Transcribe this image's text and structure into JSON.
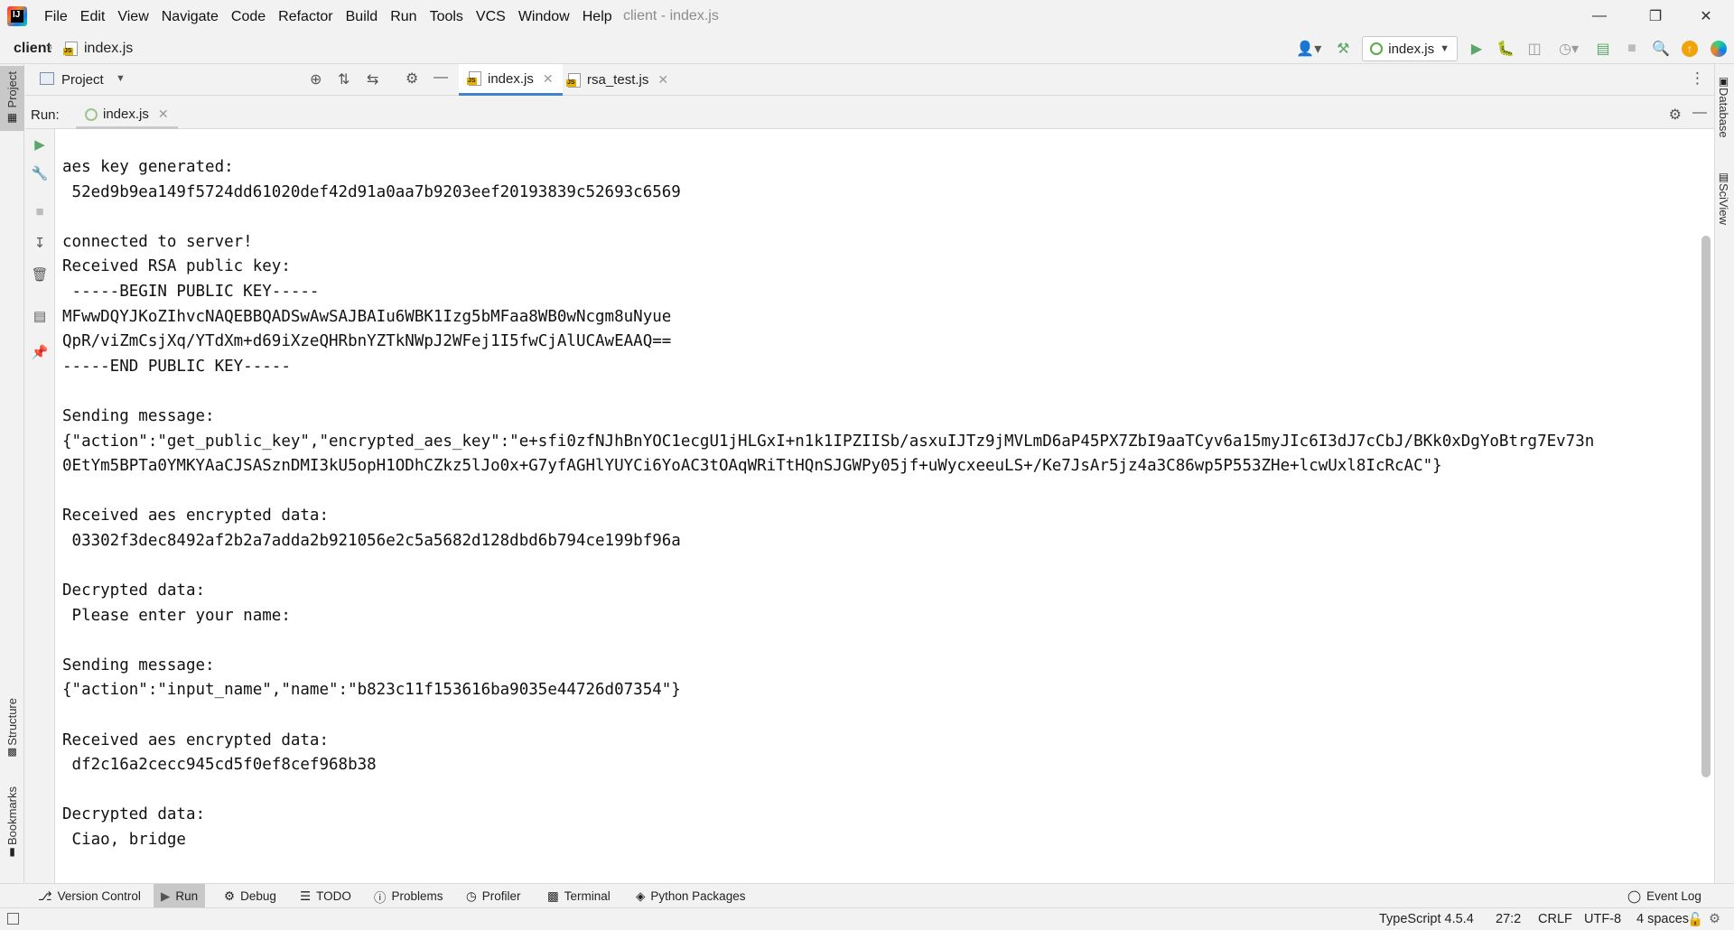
{
  "titlebar": {
    "menu": [
      "File",
      "Edit",
      "View",
      "Navigate",
      "Code",
      "Refactor",
      "Build",
      "Run",
      "Tools",
      "VCS",
      "Window",
      "Help"
    ],
    "window_title": "client - index.js"
  },
  "navbar": {
    "project": "client",
    "file": "index.js",
    "run_config": "index.js"
  },
  "project_panel": {
    "title": "Project"
  },
  "editor": {
    "tabs": [
      {
        "label": "index.js",
        "active": true
      },
      {
        "label": "rsa_test.js",
        "active": false
      }
    ]
  },
  "run_panel": {
    "label": "Run:",
    "tab": "index.js"
  },
  "console": {
    "lines": [
      "aes key generated:",
      " 52ed9b9ea149f5724dd61020def42d91a0aa7b9203eef20193839c52693c6569",
      "",
      "connected to server!",
      "Received RSA public key:",
      " -----BEGIN PUBLIC KEY-----",
      "MFwwDQYJKoZIhvcNAQEBBQADSwAwSAJBAIu6WBK1Izg5bMFaa8WB0wNcgm8uNyue",
      "QpR/viZmCsjXq/YTdXm+d69iXzeQHRbnYZTkNWpJ2WFej1I5fwCjAlUCAwEAAQ==",
      "-----END PUBLIC KEY-----",
      "",
      "Sending message:",
      "{\"action\":\"get_public_key\",\"encrypted_aes_key\":\"e+sfi0zfNJhBnYOC1ecgU1jHLGxI+n1k1IPZIISb/asxuIJTz9jMVLmD6aP45PX7ZbI9aaTCyv6a15myJIc6I3dJ7cCbJ/BKk0xDgYoBtrg7Ev73n",
      "0EtYm5BPTa0YMKYAaCJSASznDMI3kU5opH1ODhCZkz5lJo0x+G7yfAGHlYUYCi6YoAC3tOAqWRiTtHQnSJGWPy05jf+uWycxeeuLS+/Ke7JsAr5jz4a3C86wp5P553ZHe+lcwUxl8IcRcAC\"}",
      "",
      "Received aes encrypted data:",
      " 03302f3dec8492af2b2a7adda2b921056e2c5a5682d128dbd6b794ce199bf96a",
      "",
      "Decrypted data:",
      " Please enter your name:",
      "",
      "Sending message:",
      "{\"action\":\"input_name\",\"name\":\"b823c11f153616ba9035e44726d07354\"}",
      "",
      "Received aes encrypted data:",
      " df2c16a2cecc945cd5f0ef8cef968b38",
      "",
      "Decrypted data:",
      " Ciao, bridge"
    ]
  },
  "left_stripe": {
    "project": "Project",
    "structure": "Structure",
    "bookmarks": "Bookmarks"
  },
  "right_stripe": {
    "database": "Database",
    "sciview": "SciView"
  },
  "bottom_tools": {
    "version_control": "Version Control",
    "run": "Run",
    "debug": "Debug",
    "todo": "TODO",
    "problems": "Problems",
    "profiler": "Profiler",
    "terminal": "Terminal",
    "python_packages": "Python Packages",
    "event_log": "Event Log"
  },
  "statusbar": {
    "language": "TypeScript 4.5.4",
    "position": "27:2",
    "line_sep": "CRLF",
    "encoding": "UTF-8",
    "indent": "4 spaces"
  },
  "colors": {
    "accent": "#4083c9",
    "run_green": "#59a869",
    "update_orange": "#f0a30a"
  }
}
